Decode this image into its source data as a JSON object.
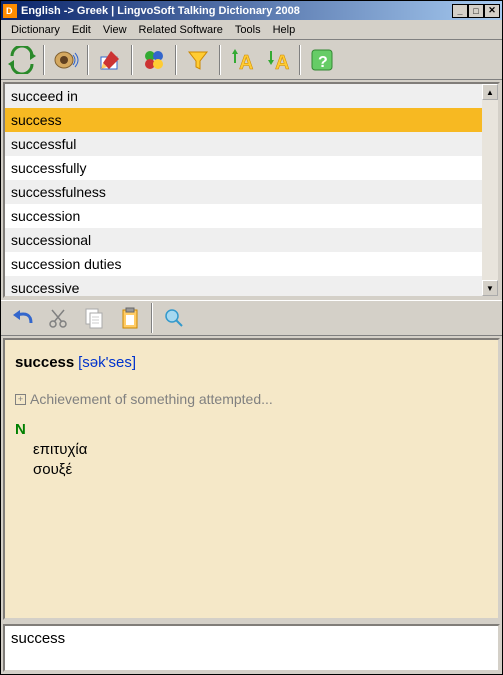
{
  "titlebar": {
    "title": "English -> Greek | LingvoSoft Talking Dictionary 2008"
  },
  "menu": {
    "items": [
      "Dictionary",
      "Edit",
      "View",
      "Related Software",
      "Tools",
      "Help"
    ]
  },
  "wordlist": {
    "items": [
      "succeed in",
      "success",
      "successful",
      "successfully",
      "successfulness",
      "succession",
      "successional",
      "succession duties",
      "successive"
    ],
    "selected_index": 1
  },
  "definition": {
    "headword": "success",
    "pronunciation": "[sək'ses]",
    "gloss": "Achievement of something attempted...",
    "pos": "N",
    "translations": [
      "επιτυχία",
      "σουξέ"
    ]
  },
  "search": {
    "value": "success"
  }
}
